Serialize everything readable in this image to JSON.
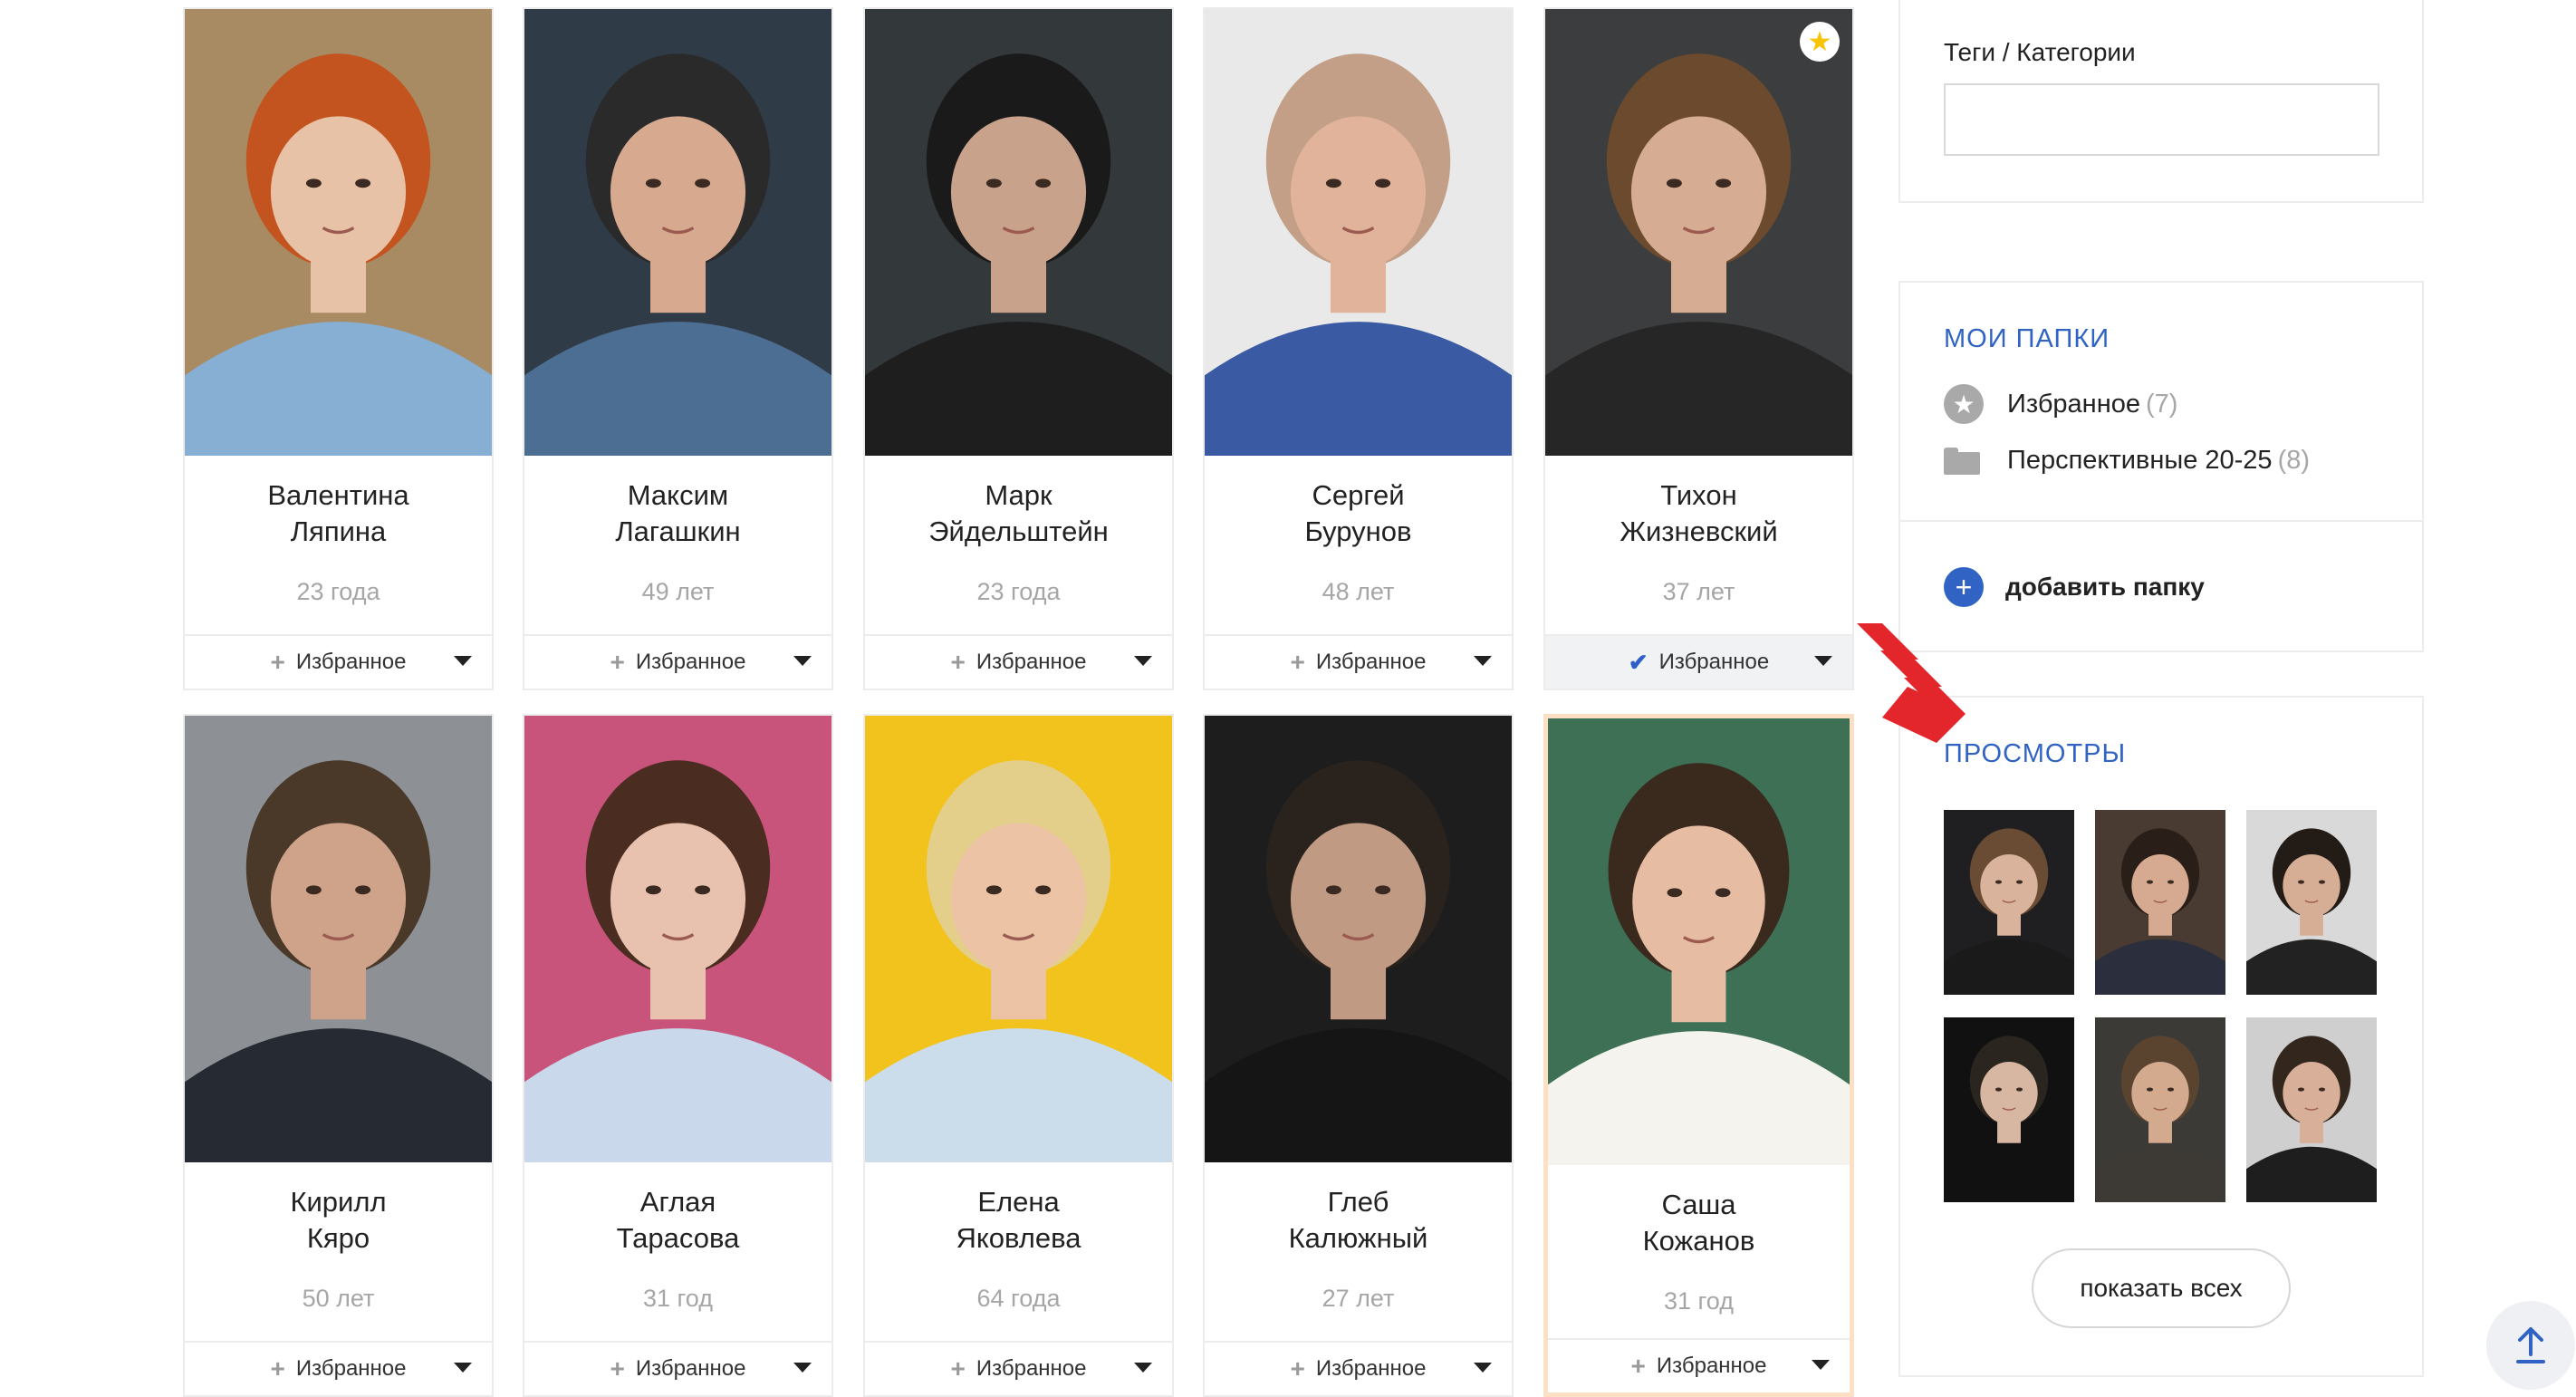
{
  "actors": [
    {
      "first": "Валентина",
      "last": "Ляпина",
      "age": "23 года",
      "fav": "Избранное",
      "active": false,
      "star": false,
      "bg": "#a88b63",
      "skin": "#e8c2a6",
      "hair": "#c3541f",
      "shirt": "#87aed3"
    },
    {
      "first": "Максим",
      "last": "Лагашкин",
      "age": "49 лет",
      "fav": "Избранное",
      "active": false,
      "star": false,
      "bg": "#2f3b47",
      "skin": "#d7a98f",
      "hair": "#2a2a2a",
      "shirt": "#4d6e93"
    },
    {
      "first": "Марк",
      "last": "Эйдельштейн",
      "age": "23 года",
      "fav": "Избранное",
      "active": false,
      "star": false,
      "bg": "#33383a",
      "skin": "#c9a28c",
      "hair": "#1a1a1a",
      "shirt": "#1e1e1e"
    },
    {
      "first": "Сергей",
      "last": "Бурунов",
      "age": "48 лет",
      "fav": "Избранное",
      "active": false,
      "star": false,
      "bg": "#e9e9e9",
      "skin": "#e1b39a",
      "hair": "#c29f86",
      "shirt": "#3a5aa3"
    },
    {
      "first": "Тихон",
      "last": "Жизневский",
      "age": "37 лет",
      "fav": "Избранное",
      "active": true,
      "star": true,
      "bg": "#3c3d3e",
      "skin": "#d6ac93",
      "hair": "#6b4a2d",
      "shirt": "#262626"
    },
    {
      "first": "Кирилл",
      "last": "Кяро",
      "age": "50 лет",
      "fav": "Избранное",
      "active": false,
      "star": false,
      "bg": "#8d9196",
      "skin": "#cfa38a",
      "hair": "#4a3828",
      "shirt": "#262b33"
    },
    {
      "first": "Аглая",
      "last": "Тарасова",
      "age": "31 год",
      "fav": "Избранное",
      "active": false,
      "star": false,
      "bg": "#c8547b",
      "skin": "#e8c2ae",
      "hair": "#4a2d20",
      "shirt": "#c9d8ea"
    },
    {
      "first": "Елена",
      "last": "Яковлева",
      "age": "64 года",
      "fav": "Избранное",
      "active": false,
      "star": false,
      "bg": "#f1c31c",
      "skin": "#ecc3a5",
      "hair": "#e4cf8a",
      "shirt": "#cbdceb"
    },
    {
      "first": "Глеб",
      "last": "Калюжный",
      "age": "27 лет",
      "fav": "Избранное",
      "active": false,
      "star": false,
      "bg": "#1d1d1d",
      "skin": "#c19a84",
      "hair": "#2a221c",
      "shirt": "#151515"
    },
    {
      "first": "Саша",
      "last": "Кожанов",
      "age": "31 год",
      "fav": "Избранное",
      "active": false,
      "star": false,
      "bg": "#3d7055",
      "skin": "#e6bda3",
      "hair": "#3a2a1e",
      "shirt": "#f5f3ee"
    }
  ],
  "sidebar": {
    "tags_label": "Теги / Категории",
    "tags_value": "",
    "folders_title": "МОИ ПАПКИ",
    "folders": [
      {
        "name": "Избранное",
        "count": "(7)",
        "icon": "star-circle-icon"
      },
      {
        "name": "Перспективные 20-25",
        "count": "(8)",
        "icon": "folder-icon"
      }
    ],
    "add_folder_label": "добавить папку",
    "views_title": "ПРОСМОТРЫ",
    "views": [
      {
        "bg": "#1f1f22",
        "skin": "#d9b39c",
        "hair": "#6a4b33",
        "shirt": "#1a1a1a"
      },
      {
        "bg": "#4a3b32",
        "skin": "#d5aa90",
        "hair": "#2a1f18",
        "shirt": "#2b2f3d"
      },
      {
        "bg": "#d9d9d9",
        "skin": "#d6ae95",
        "hair": "#231c16",
        "shirt": "#222"
      },
      {
        "bg": "#111",
        "skin": "#d8b7a2",
        "hair": "#2b2520",
        "shirt": "#111"
      },
      {
        "bg": "#3c3a36",
        "skin": "#d4aa8e",
        "hair": "#5a4430",
        "shirt": "#3d3a35"
      },
      {
        "bg": "#cfcfcf",
        "skin": "#d8b09a",
        "hair": "#33261d",
        "shirt": "#1e1e1e"
      }
    ],
    "show_all_label": "показать всех"
  },
  "colors": {
    "accent": "#3063c4",
    "arrow": "#e3262b"
  }
}
